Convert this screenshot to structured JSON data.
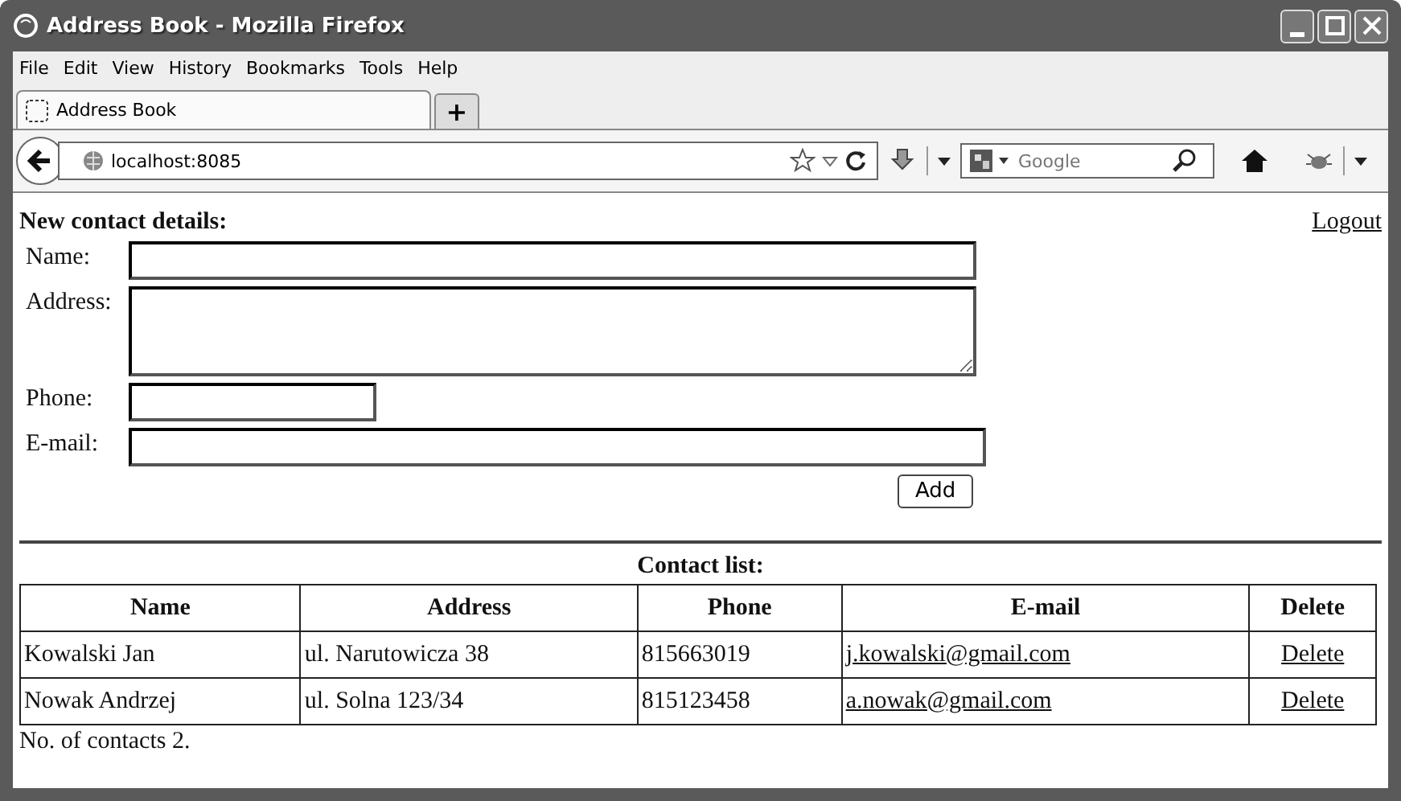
{
  "window": {
    "title": "Address Book - Mozilla Firefox"
  },
  "menu": [
    "File",
    "Edit",
    "View",
    "History",
    "Bookmarks",
    "Tools",
    "Help"
  ],
  "tabs": [
    {
      "label": "Address Book",
      "selected": true
    }
  ],
  "new_tab": "+",
  "url": "localhost:8085",
  "search": {
    "placeholder": "Google"
  },
  "page": {
    "heading": "New contact details:",
    "logout": "Logout",
    "fields": [
      {
        "label": "Name:",
        "kind": "text"
      },
      {
        "label": "Address:",
        "kind": "textarea"
      },
      {
        "label": "Phone:",
        "kind": "text"
      },
      {
        "label": "E-mail:",
        "kind": "text"
      }
    ],
    "add_button": "Add",
    "list_title": "Contact list:",
    "table": {
      "columns": [
        "Name",
        "Address",
        "Phone",
        "E-mail",
        "Delete"
      ],
      "rows": [
        {
          "name": "Kowalski Jan",
          "address": "ul. Narutowicza 38",
          "phone": "815663019",
          "email": "j.kowalski@gmail.com",
          "delete": "Delete"
        },
        {
          "name": "Nowak Andrzej",
          "address": "ul. Solna 123/34",
          "phone": "815123458",
          "email": "a.nowak@gmail.com",
          "delete": "Delete"
        }
      ]
    },
    "count": "No. of contacts 2."
  }
}
